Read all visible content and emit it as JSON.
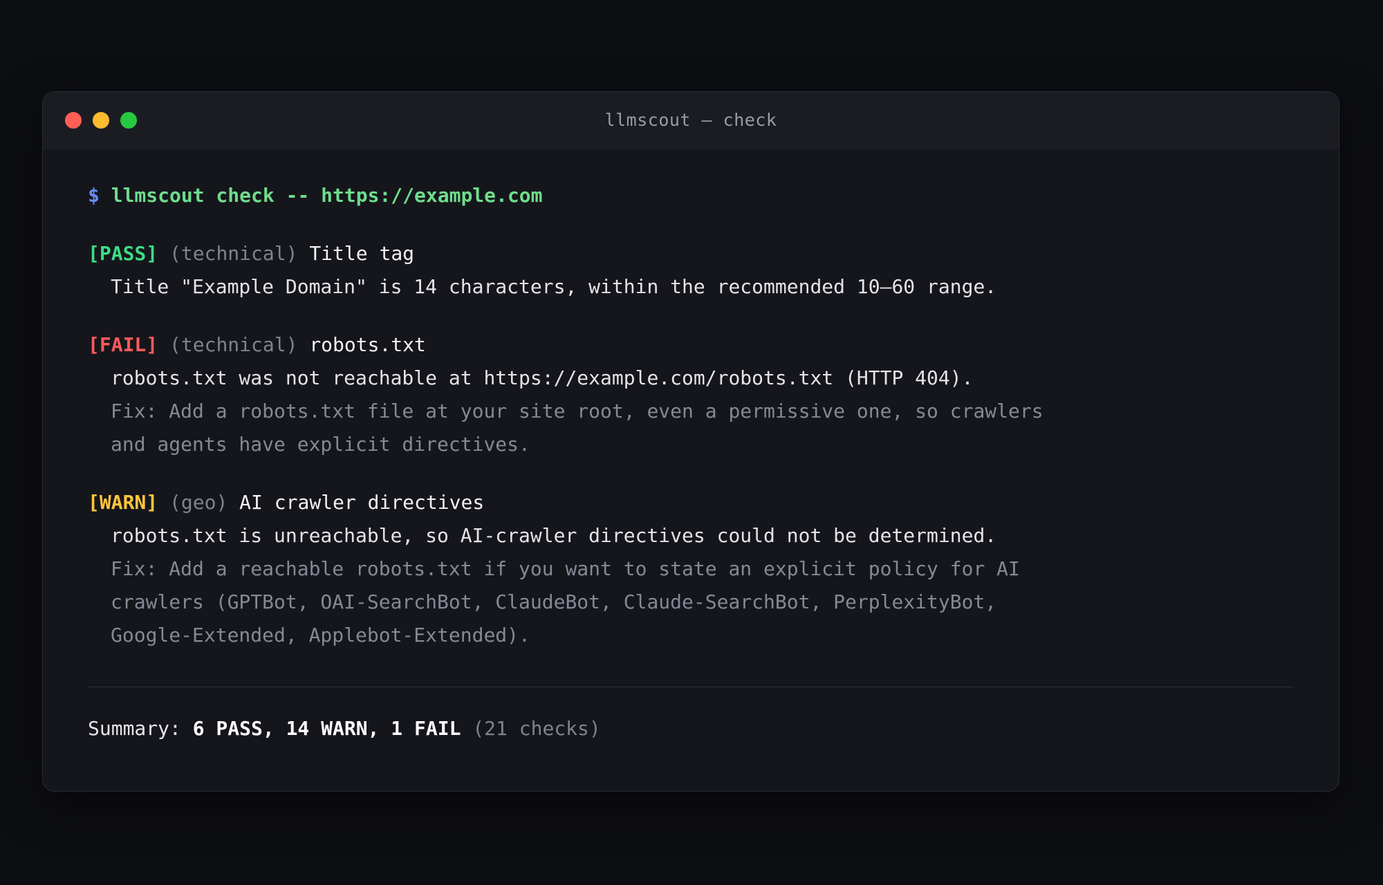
{
  "window": {
    "title": "llmscout — check",
    "controls": [
      "close",
      "minimize",
      "maximize"
    ]
  },
  "prompt": {
    "symbol": "$",
    "command": "llmscout check -- https://example.com"
  },
  "results": [
    {
      "status": "[PASS]",
      "category": "(technical)",
      "name": "Title tag",
      "desc": [
        "Title \"Example Domain\" is 14 characters, within the recommended 10–60 range."
      ],
      "fix": []
    },
    {
      "status": "[FAIL]",
      "category": "(technical)",
      "name": "robots.txt",
      "desc": [
        "robots.txt was not reachable at https://example.com/robots.txt (HTTP 404)."
      ],
      "fix": [
        "Fix: Add a robots.txt file at your site root, even a permissive one, so crawlers",
        "and agents have explicit directives."
      ]
    },
    {
      "status": "[WARN]",
      "category": "(geo)",
      "name": "AI crawler directives",
      "desc": [
        "robots.txt is unreachable, so AI-crawler directives could not be determined."
      ],
      "fix": [
        "Fix: Add a reachable robots.txt if you want to state an explicit policy for AI",
        "crawlers (GPTBot, OAI-SearchBot, ClaudeBot, Claude-SearchBot, PerplexityBot,",
        "Google-Extended, Applebot-Extended)."
      ]
    }
  ],
  "summary": {
    "label": "Summary:",
    "counts": "6 PASS, 14 WARN, 1 FAIL",
    "total": "(21 checks)"
  },
  "colors": {
    "pass": "#3ddc84",
    "fail": "#ff5a5a",
    "warn": "#ffc53d",
    "prompt": "#6fdc8c",
    "prompt_symbol": "#6a8cff"
  }
}
